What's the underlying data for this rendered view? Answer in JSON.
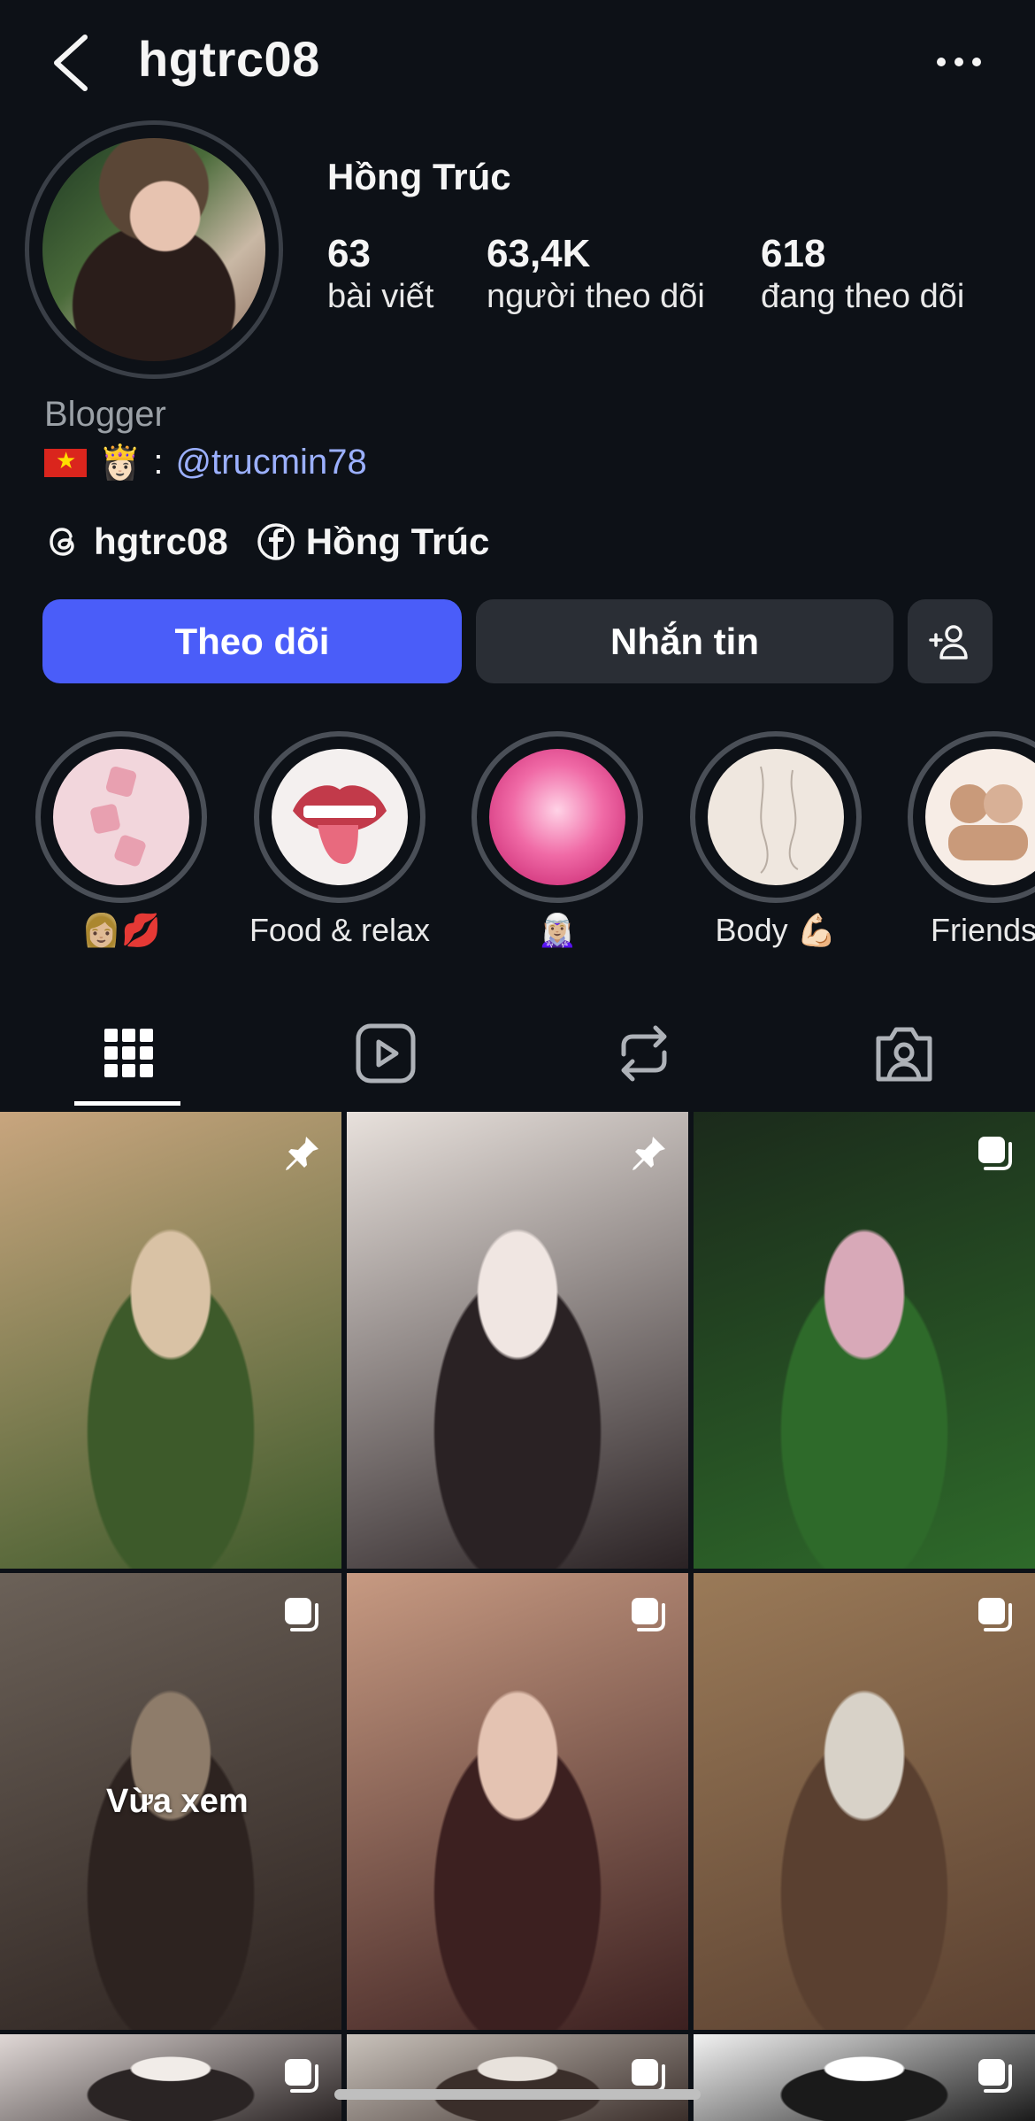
{
  "header": {
    "username": "hgtrc08",
    "back_icon": "chevron-left-icon",
    "more_icon": "more-horizontal-icon"
  },
  "profile": {
    "display_name": "Hồng Trúc",
    "stats": [
      {
        "value": "63",
        "label": "bài viết"
      },
      {
        "value": "63,4K",
        "label": "người theo dõi"
      },
      {
        "value": "618",
        "label": "đang theo dõi"
      }
    ],
    "category": "Blogger",
    "bio_emojis": "👸🏻",
    "bio_separator": ":",
    "bio_mention": "@trucmin78",
    "threads_handle": "hgtrc08",
    "facebook_name": "Hồng Trúc"
  },
  "buttons": {
    "follow": "Theo dõi",
    "message": "Nhắn tin",
    "add_user_icon": "person-add-icon"
  },
  "highlights": [
    {
      "label": "👩🏼💋",
      "colors": [
        "#f2d6dc",
        "#e8b5c0"
      ]
    },
    {
      "label": "Food & relax",
      "colors": [
        "#f4f0ef",
        "#c23a4a"
      ]
    },
    {
      "label": "🧝🏼‍♀️",
      "colors": [
        "#f06aa6",
        "#c21b68"
      ]
    },
    {
      "label": "Body 💪🏻",
      "colors": [
        "#efe7df",
        "#d8ccc0"
      ]
    },
    {
      "label": "Friends",
      "colors": [
        "#f7ede6",
        "#c99a7a"
      ]
    }
  ],
  "tabs": [
    {
      "name": "grid-icon",
      "active": true
    },
    {
      "name": "reels-icon",
      "active": false
    },
    {
      "name": "reposts-icon",
      "active": false
    },
    {
      "name": "tagged-icon",
      "active": false
    }
  ],
  "grid": {
    "recently_viewed_label": "Vừa xem",
    "cells": [
      {
        "badge": "pin-icon",
        "colors": [
          "#c8a57e",
          "#3d5a2a",
          "#d9c2a5"
        ]
      },
      {
        "badge": "pin-icon",
        "colors": [
          "#e8e1dc",
          "#2a2224",
          "#f0e6e2"
        ]
      },
      {
        "badge": "carousel-icon",
        "colors": [
          "#1b2a1b",
          "#2e6a2a",
          "#d8a9b8"
        ]
      },
      {
        "badge": "carousel-icon",
        "colors": [
          "#6b6158",
          "#2d2320",
          "#8e7c6a"
        ]
      },
      {
        "badge": "carousel-icon",
        "colors": [
          "#c79a82",
          "#3c2020",
          "#e4c3b2"
        ]
      },
      {
        "badge": "carousel-icon",
        "colors": [
          "#9a7a58",
          "#5a4030",
          "#d8d2c8"
        ]
      },
      {
        "badge": "carousel-icon",
        "colors": [
          "#e0d8d6",
          "#2a2424",
          "#f1ece8"
        ]
      },
      {
        "badge": "carousel-icon",
        "colors": [
          "#c9c2bb",
          "#3a2e2a",
          "#e8e2dc"
        ]
      },
      {
        "badge": "carousel-icon",
        "colors": [
          "#f2f2f2",
          "#1a1a1a",
          "#ffffff"
        ]
      }
    ]
  }
}
